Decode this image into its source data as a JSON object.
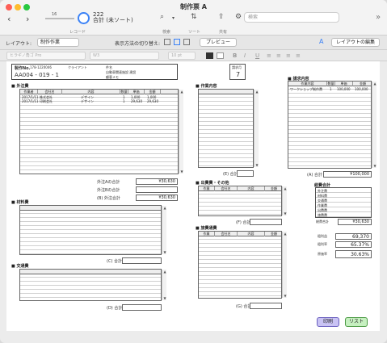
{
  "window": {
    "title": "制作票 A"
  },
  "toolbar": {
    "record_slider_value": "16",
    "record_total": "222",
    "record_status": "合計 (未ソート)",
    "record_label": "レコード",
    "search_label": "検索",
    "sort_label": "ソート",
    "share_label": "共有",
    "search_placeholder": "検索"
  },
  "layoutbar": {
    "layout_label": "レイアウト:",
    "layout_value": "制作作業",
    "view_label": "表示方法の切り替え:",
    "preview_label": "プレビュー",
    "edit_layout_label": "レイアウトの編集"
  },
  "formatbar": {
    "font_placeholder": "ヒラギノ角ゴ Pro",
    "style_placeholder": "W3",
    "size_placeholder": "10 pt"
  },
  "header": {
    "production_no_label": "製作No.",
    "production_no_value": "AA004 - 019 - 1",
    "date_value": "178-1220046",
    "client_label": "クライアント",
    "client_value": "",
    "subject_label": "件名",
    "subject_value": "自動車関連施設 建設",
    "note_label": "顧客メモ",
    "page_label": "請求月",
    "page_value": "7"
  },
  "sections": {
    "outsourcing": "■ 外注費",
    "materials": "■ 材料費",
    "transport": "■ 交通費",
    "work_content": "■ 作業内容",
    "billing": "■ 請求内容",
    "misc_expenses": "■ 出費費・その他",
    "travel": "■ 旅費通費",
    "grand_total": "総費合計"
  },
  "columns": {
    "outsourcing": [
      "作業者",
      "会社名",
      "内容",
      "数量",
      "単価",
      "金額",
      "",
      ""
    ],
    "misc": [
      "作業",
      "会社名",
      "内容",
      "金額"
    ],
    "billing": [
      "作業内容",
      "数量",
      "単価",
      "金額"
    ]
  },
  "outsourcing_rows": [
    {
      "a": "2017/1/11",
      "b": "株式会社",
      "c": "デザイン",
      "d": "1",
      "e": "1,000",
      "f": "1,000"
    },
    {
      "a": "2017/1/11",
      "b": "印刷会社",
      "c": "デザイン",
      "d": "1",
      "e": "29,630",
      "f": "29,630"
    }
  ],
  "billing_rows": [
    {
      "a": "ワークショップ制作費",
      "b": "1",
      "c": "100,000",
      "d": "100,000"
    }
  ],
  "totals": {
    "outsourcing_a_label": "外注Aの合計",
    "outsourcing_a_value": "¥30,630",
    "outsourcing_b_label": "外注Bの合計",
    "outsourcing_b_value": "",
    "outsourcing_total_label": "(B) 外注合計",
    "outsourcing_total_value": "¥30,630",
    "work_total_label": "(E) 合計",
    "billing_total_label": "(A) 合計",
    "billing_total_value": "¥100,000",
    "materials_total_label": "(C) 合計",
    "misc_total_label": "(F) 合計",
    "travel_total_label": "(G) 合計",
    "transport_total_label": "(D) 合計"
  },
  "summary": {
    "rows": [
      "外注費",
      "材料費",
      "交通費",
      "作業費",
      "出費費",
      "旅費費"
    ],
    "total_label": "総費合計",
    "total_value": "¥30,630",
    "profit_label": "粗利益",
    "profit_value": "69,370",
    "profit_rate_label": "粗利率",
    "profit_rate_value": "65.37%",
    "cost_rate_label": "原価率",
    "cost_rate_value": "30.63%"
  },
  "buttons": {
    "print": "印刷",
    "list": "リスト"
  }
}
